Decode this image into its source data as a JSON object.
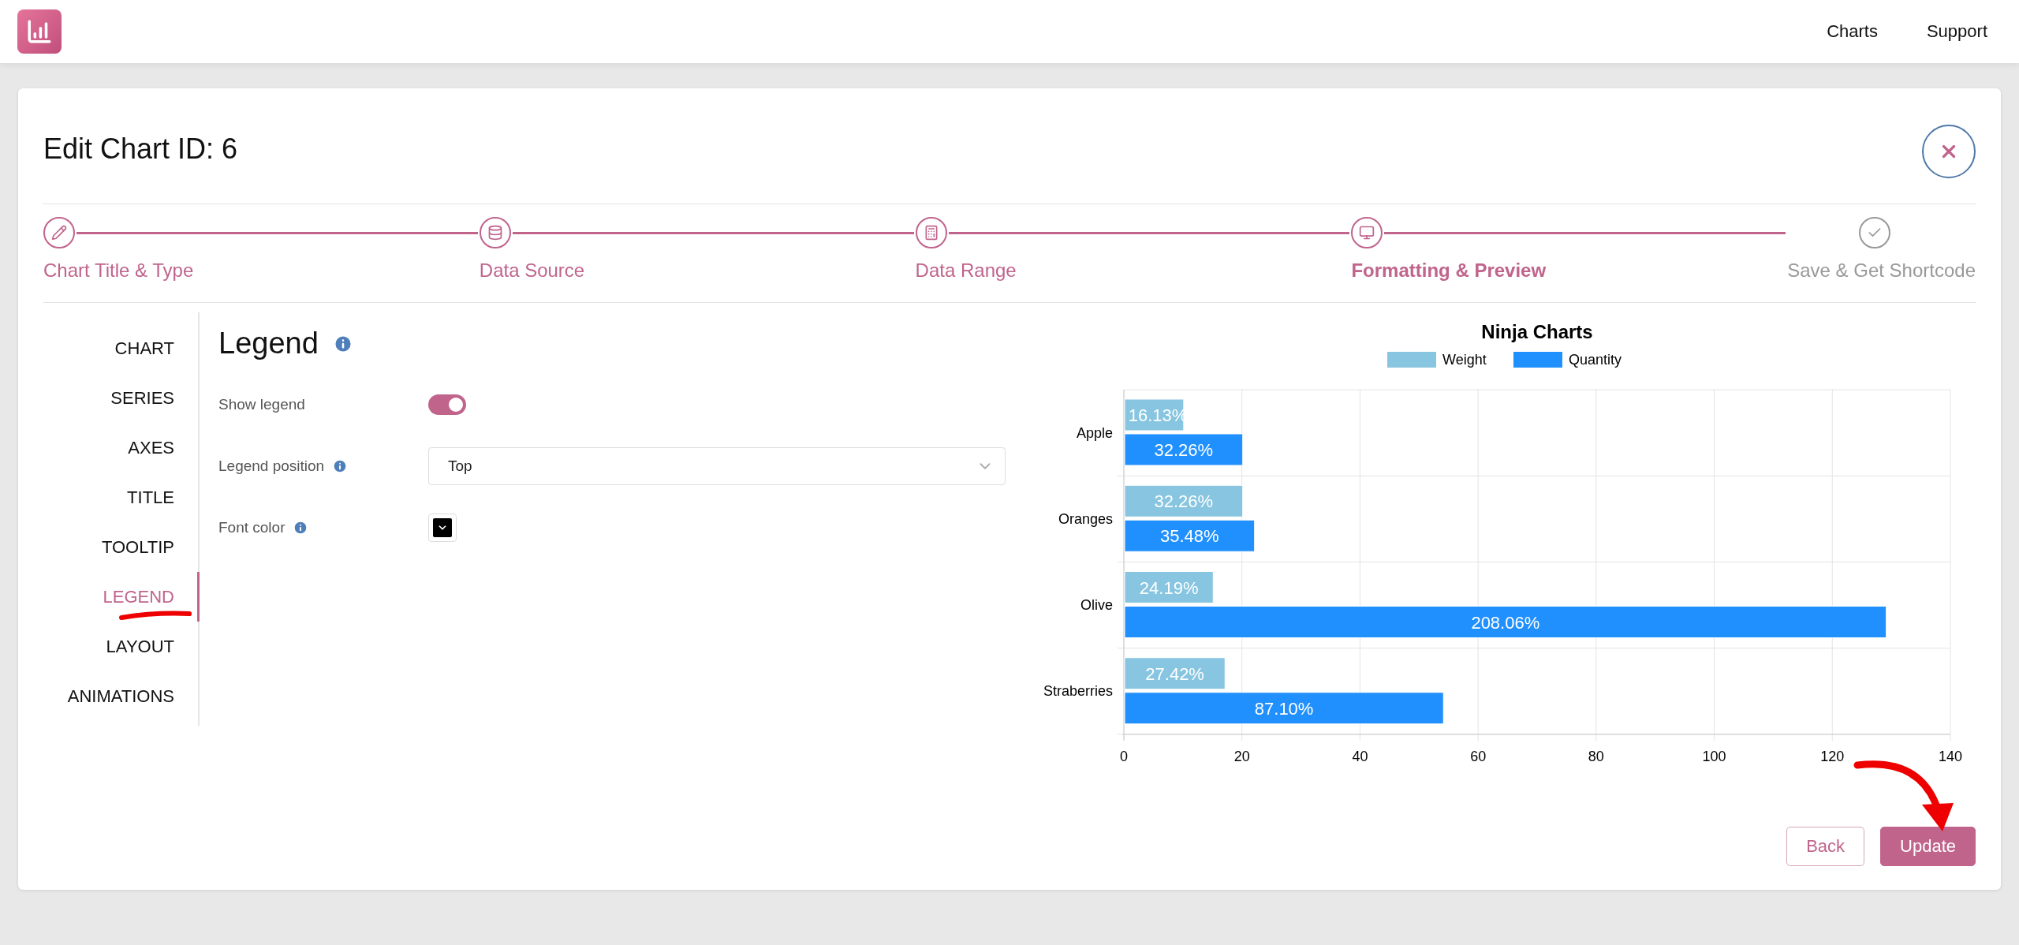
{
  "topbar": {
    "nav": [
      {
        "label": "Charts"
      },
      {
        "label": "Support"
      }
    ]
  },
  "card": {
    "title": "Edit Chart ID: 6"
  },
  "steps": [
    {
      "label": "Chart Title & Type",
      "selected": false,
      "disabled": false
    },
    {
      "label": "Data Source",
      "selected": false,
      "disabled": false
    },
    {
      "label": "Data Range",
      "selected": false,
      "disabled": false
    },
    {
      "label": "Formatting & Preview",
      "selected": true,
      "disabled": false
    },
    {
      "label": "Save & Get Shortcode",
      "selected": false,
      "disabled": true
    }
  ],
  "sidebar": {
    "items": [
      {
        "label": "CHART",
        "selected": false
      },
      {
        "label": "SERIES",
        "selected": false
      },
      {
        "label": "AXES",
        "selected": false
      },
      {
        "label": "TITLE",
        "selected": false
      },
      {
        "label": "TOOLTIP",
        "selected": false
      },
      {
        "label": "LEGEND",
        "selected": true
      },
      {
        "label": "LAYOUT",
        "selected": false
      },
      {
        "label": "ANIMATIONS",
        "selected": false
      }
    ]
  },
  "panel": {
    "heading": "Legend",
    "info": true,
    "fields": [
      {
        "kind": "toggle",
        "label": "Show legend",
        "info": false,
        "on": true
      },
      {
        "kind": "select",
        "label": "Legend position",
        "info": true,
        "value": "Top"
      },
      {
        "kind": "color",
        "label": "Font color",
        "info": true,
        "color": "#000000"
      }
    ]
  },
  "preview": {
    "chart_data": {
      "type": "bar",
      "orientation": "horizontal",
      "title": "Ninja Charts",
      "categories": [
        "Apple",
        "Oranges",
        "Olive",
        "Straberries"
      ],
      "series": [
        {
          "name": "Weight",
          "color": "#87c5e0",
          "values": [
            10,
            20,
            15,
            17
          ]
        },
        {
          "name": "Quantity",
          "color": "#2190ff",
          "values": [
            20,
            22,
            129,
            54
          ]
        }
      ],
      "xlim": [
        0,
        140
      ],
      "xticks": [
        0,
        20,
        40,
        60,
        80,
        100,
        120,
        140
      ],
      "grid": true,
      "legend": true,
      "value_labels": [
        [
          "16.13%",
          "32.26%",
          "24.19%",
          "27.42%"
        ],
        [
          "32.26%",
          "35.48%",
          "208.06%",
          "87.10%"
        ]
      ]
    }
  },
  "buttons": [
    {
      "label": "Back",
      "kind": "secondary"
    },
    {
      "label": "Update",
      "kind": "primary"
    }
  ]
}
